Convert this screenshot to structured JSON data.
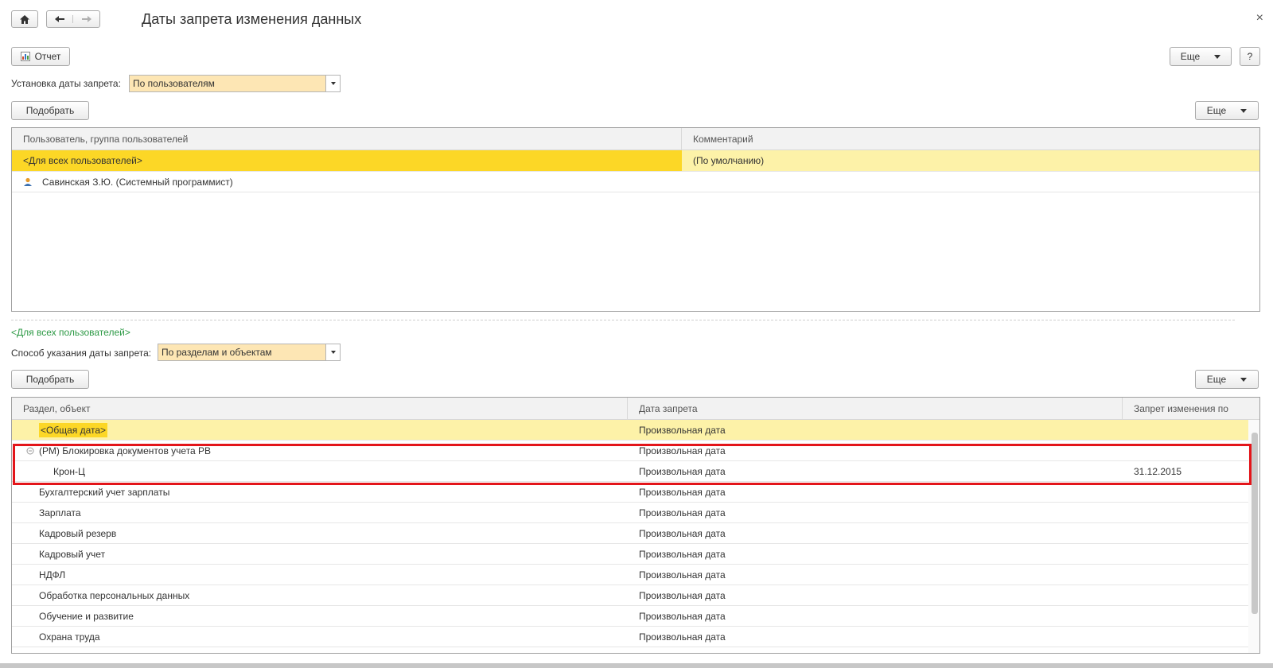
{
  "window": {
    "title": "Даты запрета изменения данных",
    "close_glyph": "×"
  },
  "nav": {
    "home_icon": "home-icon",
    "back_icon": "arrow-left-icon",
    "forward_icon": "arrow-right-icon"
  },
  "toolbar": {
    "report_label": "Отчет",
    "more_label": "Еще",
    "help_label": "?"
  },
  "setting": {
    "label": "Установка даты запрета:",
    "value": "По пользователям"
  },
  "users_section": {
    "pick_label": "Подобрать",
    "more_label": "Еще",
    "columns": [
      "Пользователь, группа пользователей",
      "Комментарий"
    ],
    "rows": [
      {
        "user": "<Для всех пользователей>",
        "comment": "(По умолчанию)"
      },
      {
        "user": "Савинская З.Ю. (Системный программист)",
        "comment": ""
      }
    ]
  },
  "selected_user_link": "<Для всех пользователей>",
  "method": {
    "label": "Способ указания даты запрета:",
    "value": "По разделам и объектам"
  },
  "sections": {
    "pick_label": "Подобрать",
    "more_label": "Еще",
    "columns": [
      "Раздел, объект",
      "Дата запрета",
      "Запрет изменения по"
    ],
    "rows": [
      {
        "name": "<Общая дата>",
        "date_kind": "Произвольная дата",
        "until": ""
      },
      {
        "name": "(РМ) Блокировка документов учета РВ",
        "date_kind": "Произвольная дата",
        "until": ""
      },
      {
        "name": "Крон-Ц",
        "date_kind": "Произвольная дата",
        "until": "31.12.2015"
      },
      {
        "name": "Бухгалтерский учет зарплаты",
        "date_kind": "Произвольная дата",
        "until": ""
      },
      {
        "name": "Зарплата",
        "date_kind": "Произвольная дата",
        "until": ""
      },
      {
        "name": "Кадровый резерв",
        "date_kind": "Произвольная дата",
        "until": ""
      },
      {
        "name": "Кадровый учет",
        "date_kind": "Произвольная дата",
        "until": ""
      },
      {
        "name": "НДФЛ",
        "date_kind": "Произвольная дата",
        "until": ""
      },
      {
        "name": "Обработка персональных данных",
        "date_kind": "Произвольная дата",
        "until": ""
      },
      {
        "name": "Обучение и развитие",
        "date_kind": "Произвольная дата",
        "until": ""
      },
      {
        "name": "Охрана труда",
        "date_kind": "Произвольная дата",
        "until": ""
      }
    ]
  },
  "colors": {
    "selected_row": "#fcd726",
    "highlight_row": "#fdf2a8",
    "combo_bg": "#fde6b4",
    "link_green": "#2e9a46",
    "annotation_red": "#e3151a"
  }
}
